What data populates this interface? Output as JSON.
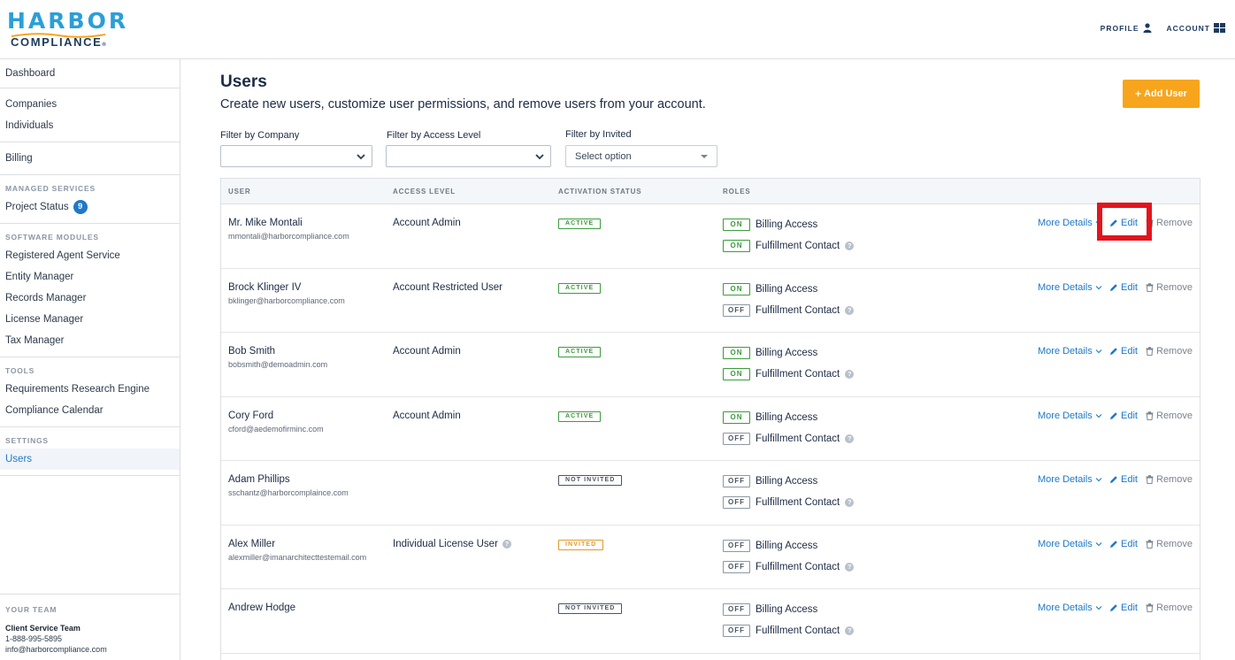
{
  "header": {
    "logo_top": "HARBOR",
    "logo_bottom": "COMPLIANCE",
    "logo_mark": "®",
    "profile_label": "PROFILE",
    "account_label": "ACCOUNT"
  },
  "sidebar": {
    "dashboard": "Dashboard",
    "companies": "Companies",
    "individuals": "Individuals",
    "billing": "Billing",
    "managed_services_heading": "MANAGED SERVICES",
    "project_status": "Project Status",
    "project_status_count": "9",
    "software_modules_heading": "SOFTWARE MODULES",
    "modules": [
      "Registered Agent Service",
      "Entity Manager",
      "Records Manager",
      "License Manager",
      "Tax Manager"
    ],
    "tools_heading": "TOOLS",
    "tools": [
      "Requirements Research Engine",
      "Compliance Calendar"
    ],
    "settings_heading": "SETTINGS",
    "users": "Users",
    "team_heading": "YOUR TEAM",
    "team_name": "Client Service Team",
    "team_phone": "1-888-995-5895",
    "team_email": "info@harborcompliance.com"
  },
  "page": {
    "title": "Users",
    "subtitle": "Create new users, customize user permissions, and remove users from your account.",
    "add_user": "Add User"
  },
  "filters": {
    "company_label": "Filter by Company",
    "access_label": "Filter by Access Level",
    "invited_label": "Filter by Invited",
    "invited_placeholder": "Select option"
  },
  "table": {
    "columns": [
      "USER",
      "ACCESS LEVEL",
      "ACTIVATION STATUS",
      "ROLES"
    ],
    "role_names": [
      "Billing Access",
      "Fulfillment Contact"
    ],
    "actions": {
      "more": "More Details",
      "edit": "Edit",
      "remove": "Remove"
    },
    "rows": [
      {
        "name": "Mr. Mike Montali",
        "email": "mmontali@harborcompliance.com",
        "access": "Account Admin",
        "status": "ACTIVE",
        "billing": "ON",
        "fulfillment": "ON"
      },
      {
        "name": "Brock Klinger IV",
        "email": "bklinger@harborcompliance.com",
        "access": "Account Restricted User",
        "status": "ACTIVE",
        "billing": "ON",
        "fulfillment": "OFF"
      },
      {
        "name": "Bob Smith",
        "email": "bobsmith@demoadmin.com",
        "access": "Account Admin",
        "status": "ACTIVE",
        "billing": "ON",
        "fulfillment": "ON"
      },
      {
        "name": "Cory Ford",
        "email": "cford@aedemofirminc.com",
        "access": "Account Admin",
        "status": "ACTIVE",
        "billing": "ON",
        "fulfillment": "OFF"
      },
      {
        "name": "Adam Phillips",
        "email": "sschantz@harborcomplaince.com",
        "access": "",
        "status": "NOT INVITED",
        "billing": "OFF",
        "fulfillment": "OFF"
      },
      {
        "name": "Alex Miller",
        "email": "alexmiller@imanarchitecttestemail.com",
        "access": "Individual License User",
        "status": "INVITED",
        "billing": "OFF",
        "fulfillment": "OFF"
      },
      {
        "name": "Andrew Hodge",
        "email": "",
        "access": "",
        "status": "NOT INVITED",
        "billing": "OFF",
        "fulfillment": "OFF"
      }
    ]
  },
  "colors": {
    "accent": "#1f78c8",
    "add_button": "#f7a51c",
    "active": "#3d9b3d",
    "invited": "#e09a2a",
    "highlight": "#e2141d"
  }
}
